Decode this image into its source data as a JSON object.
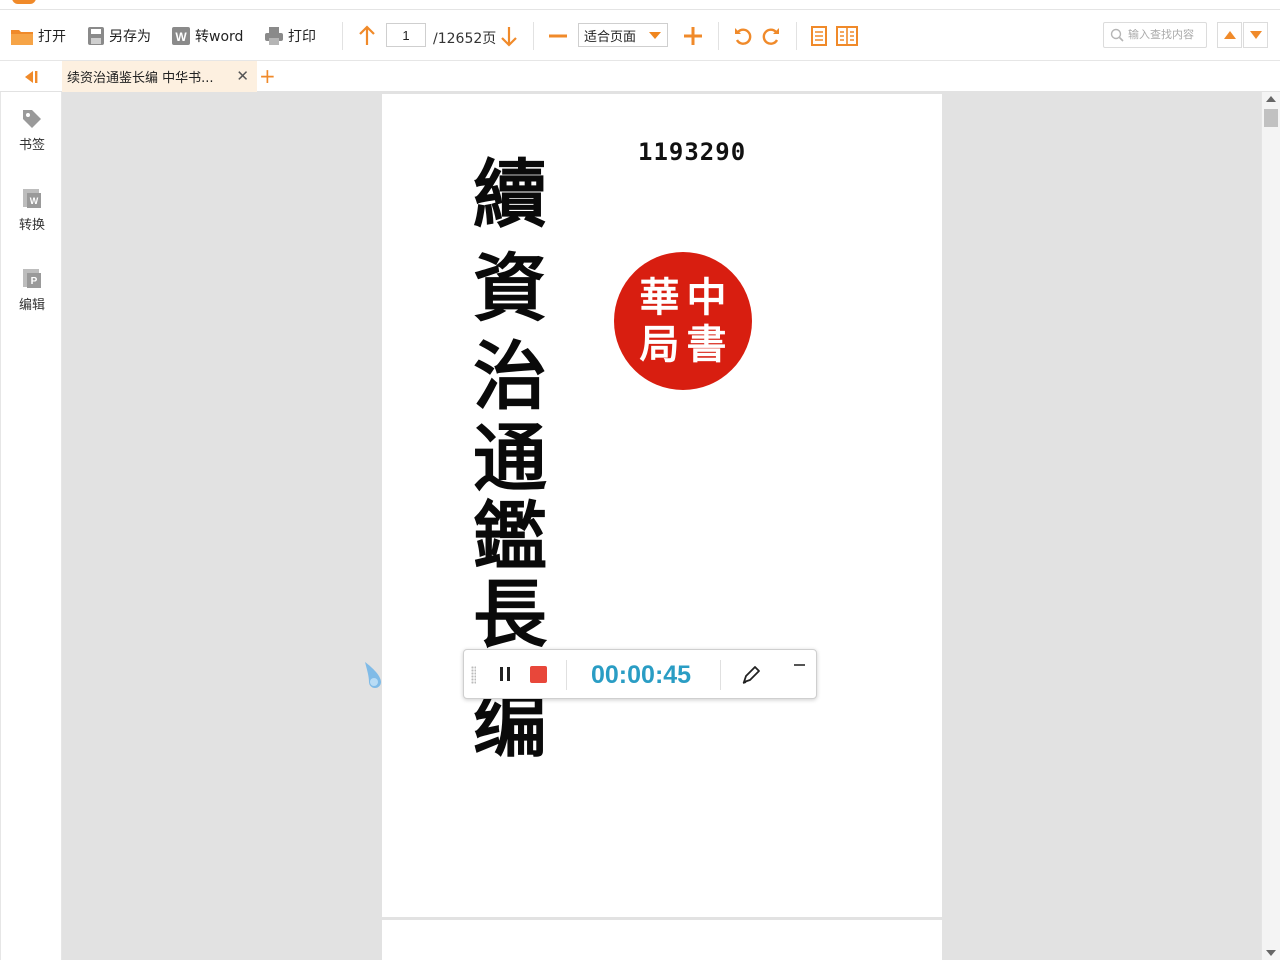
{
  "toolbar": {
    "open_label": "打开",
    "saveas_label": "另存为",
    "toword_label": "转word",
    "print_label": "打印",
    "page_current": "1",
    "page_total": "/12652页",
    "zoom_value": "适合页面",
    "search_placeholder": "输入查找内容"
  },
  "tabs": [
    {
      "label": "续资治通鉴长编 中华书..."
    }
  ],
  "sidebar": {
    "items": [
      {
        "label": "书签",
        "icon": "tag-icon"
      },
      {
        "label": "转换",
        "icon": "word-convert-icon"
      },
      {
        "label": "编辑",
        "icon": "pdf-edit-icon"
      }
    ]
  },
  "document": {
    "stamp_number": "1193290",
    "title_chars": [
      "續",
      "資",
      "治",
      "通",
      "鑑",
      "長",
      "编"
    ],
    "seal_chars": [
      "中",
      "華",
      "書",
      "局"
    ]
  },
  "recorder": {
    "elapsed": "00:00:45"
  },
  "colors": {
    "accent": "#f08a2a",
    "seal_red": "#d81e10",
    "recorder_time": "#2a9dc4",
    "stop_red": "#e8473a",
    "tab_bg": "#fdf0e0",
    "doc_bg": "#e2e2e2"
  }
}
